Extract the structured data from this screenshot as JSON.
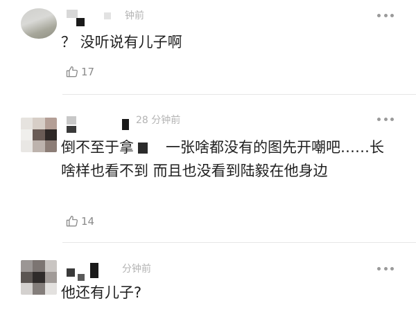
{
  "comments": [
    {
      "time": "钟前",
      "content": "？ 没听说有儿子啊",
      "likes": "17"
    },
    {
      "time": "28 分钟前",
      "content_before": "倒不至于拿",
      "content_after": "一张啥都没有的图先开嘲吧……长啥样也看不到 而且也没看到陆毅在他身边",
      "likes": "14"
    },
    {
      "time": "分钟前",
      "content": "他还有儿子?"
    }
  ],
  "icons": {
    "like": "thumbs-up-icon",
    "more": "more-dots-icon"
  },
  "colors": {
    "meta_text": "#b3b3b3",
    "like_text": "#8a8a8a",
    "divider": "#e6e6e6"
  }
}
